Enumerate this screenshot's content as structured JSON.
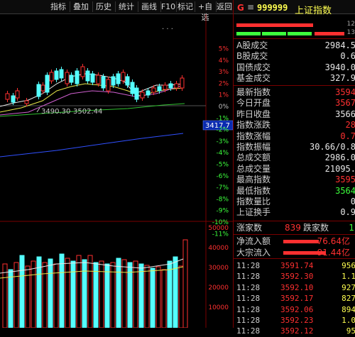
{
  "toolbar": {
    "items": [
      "指标",
      "叠加",
      "历史",
      "统计",
      "画线",
      "F10",
      "标记",
      "+自选",
      "返回"
    ]
  },
  "price_chart": {
    "current_price_tag": "3417.7",
    "annotation_low_1": "3490.30",
    "annotation_low_2": "3502.44",
    "dots": "· · ·",
    "pct_labels_up": [
      "5%",
      "4%",
      "3%",
      "2%",
      "1%"
    ],
    "pct_label_mid": "0%",
    "pct_labels_down": [
      "-1%",
      "-2%",
      "-3%",
      "-4%",
      "-5%",
      "-6%",
      "-7%",
      "-8%",
      "-9%",
      "-10%",
      "-11%"
    ]
  },
  "volume_chart": {
    "scale_labels": [
      "50000",
      "40000",
      "30000",
      "20000",
      "10000"
    ]
  },
  "stock": {
    "code": "999999",
    "name": "上证指数",
    "g_label": "G",
    "menu_icon": "≡",
    "bar_top_value": "12",
    "bar_bottom_value": "13"
  },
  "market_stats": [
    {
      "label": "A股成交",
      "value": "2984.5",
      "color": "#e8e8e8"
    },
    {
      "label": "B股成交",
      "value": "0.6",
      "color": "#e8e8e8"
    },
    {
      "label": "国债成交",
      "value": "3940.0",
      "color": "#e8e8e8"
    },
    {
      "label": "基金成交",
      "value": "327.9",
      "color": "#e8e8e8"
    }
  ],
  "index_stats": [
    {
      "label": "最新指数",
      "value": "3594",
      "color": "#ff3030"
    },
    {
      "label": "今日开盘",
      "value": "3567",
      "color": "#ff3030"
    },
    {
      "label": "昨日收盘",
      "value": "3566",
      "color": "#e8e8e8"
    },
    {
      "label": "指数涨跌",
      "value": "28",
      "color": "#ff3030"
    },
    {
      "label": "指数涨幅",
      "value": "0.7",
      "color": "#ff3030"
    },
    {
      "label": "指数振幅",
      "value": "30.66/0.8",
      "color": "#e8e8e8"
    },
    {
      "label": "总成交额",
      "value": "2986.0",
      "color": "#e8e8e8"
    },
    {
      "label": "总成交量",
      "value": "21095.",
      "color": "#e8e8e8"
    },
    {
      "label": "最高指数",
      "value": "3595",
      "color": "#ff3030"
    },
    {
      "label": "最低指数",
      "value": "3564",
      "color": "#3cff3c"
    },
    {
      "label": "指数量比",
      "value": "0",
      "color": "#e8e8e8"
    },
    {
      "label": "上证换手",
      "value": "0.9",
      "color": "#e8e8e8"
    }
  ],
  "breadth": {
    "up_label": "涨家数",
    "up_value": "839",
    "down_label": "跌家数",
    "down_value": "1"
  },
  "flows": [
    {
      "label": "净流入额",
      "value": "76.64亿"
    },
    {
      "label": "大宗流入",
      "value": "91.44亿"
    }
  ],
  "ticks": [
    {
      "time": "11:28",
      "price": "3591.74",
      "vol": "956"
    },
    {
      "time": "11:28",
      "price": "3592.30",
      "vol": "1.1"
    },
    {
      "time": "11:28",
      "price": "3592.10",
      "vol": "927"
    },
    {
      "time": "11:28",
      "price": "3592.17",
      "vol": "827"
    },
    {
      "time": "11:28",
      "price": "3592.06",
      "vol": "894"
    },
    {
      "time": "11:28",
      "price": "3592.23",
      "vol": "1.0"
    },
    {
      "time": "11:28",
      "price": "3592.12",
      "vol": "95"
    }
  ],
  "colors": {
    "up": "#ff3030",
    "down": "#3cff3c",
    "cyan": "#54ffff",
    "ma_white": "#e8e8e8",
    "ma_yellow": "#e8e84a",
    "ma_magenta": "#d060d0",
    "ma_green": "#30c030",
    "ma_blue": "#3050ff",
    "border": "#7a0000"
  }
}
